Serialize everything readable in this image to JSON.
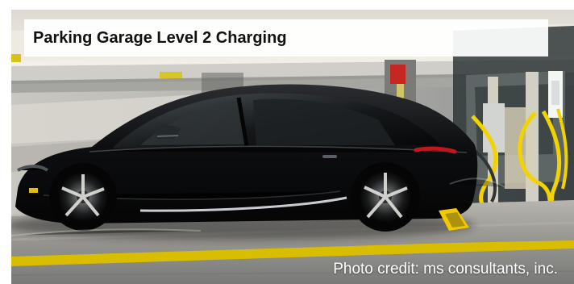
{
  "caption": {
    "title": "Parking Garage Level 2 Charging",
    "credit": "Photo credit: ms consultants, inc."
  },
  "scene": {
    "subject": "black electric SUV",
    "colors": {
      "garage_floor": "#9b9a96",
      "garage_ceiling": "#d7d5cf",
      "car_body": "#111213",
      "charger_cable": "#f0d300",
      "parking_line": "#d8bd00"
    }
  }
}
